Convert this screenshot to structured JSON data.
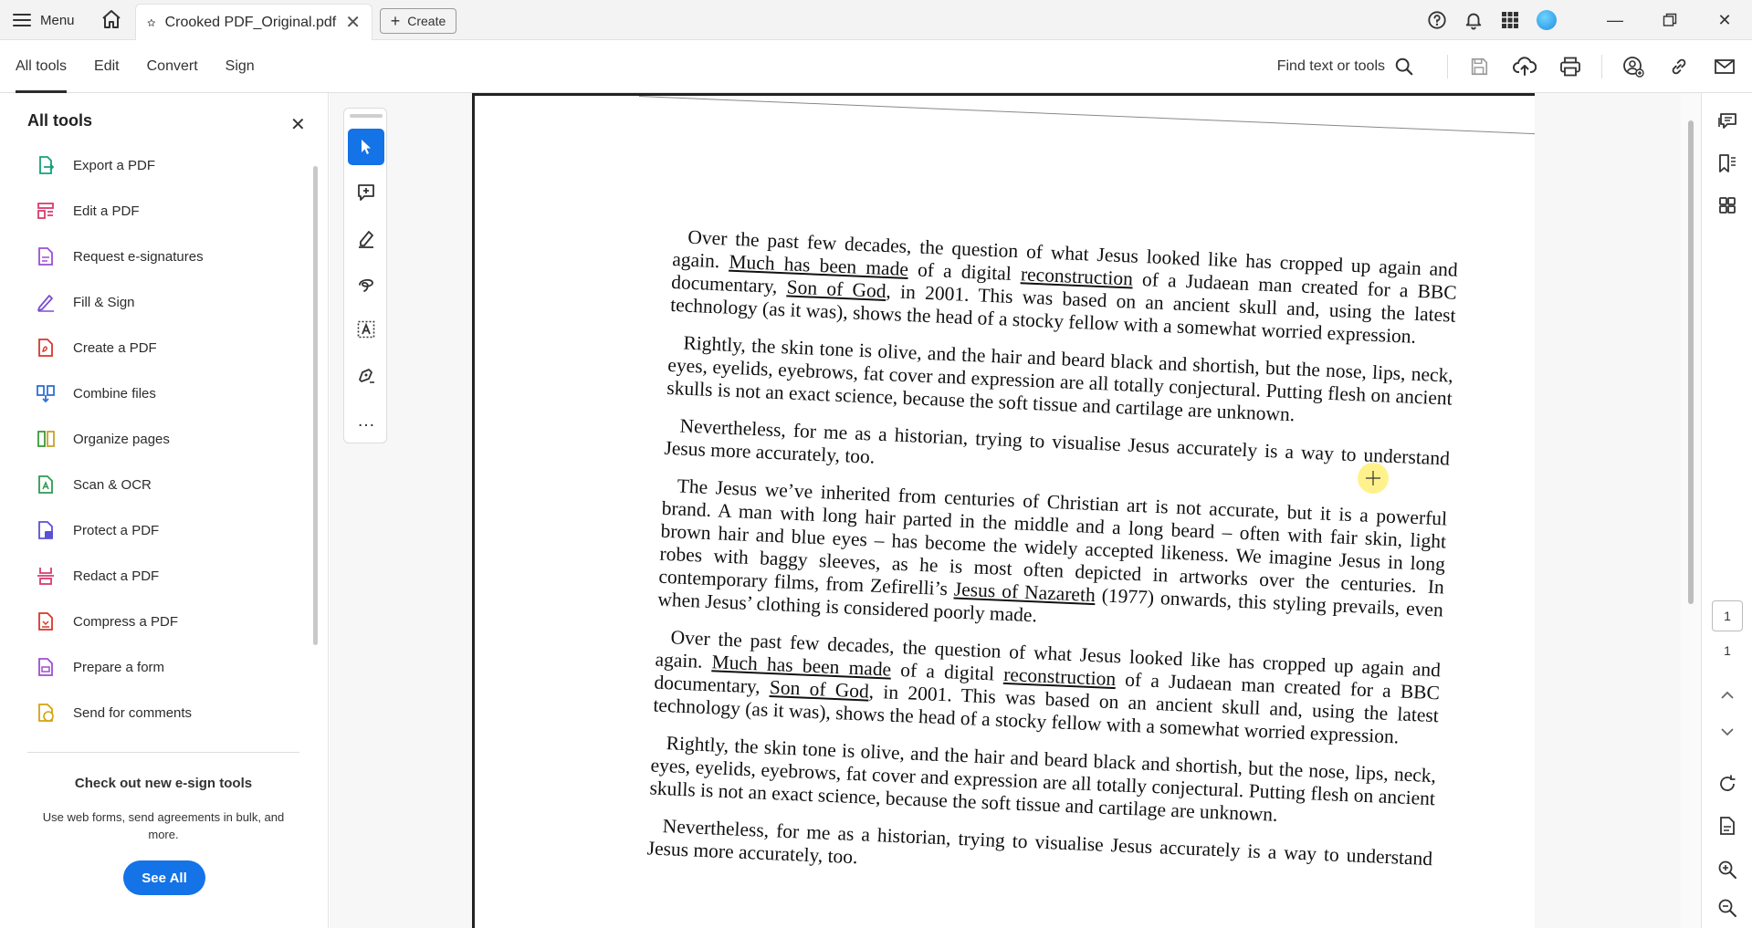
{
  "titlebar": {
    "menu_label": "Menu",
    "tab_title": "Crooked PDF_Original.pdf",
    "create_label": "Create",
    "avatar_color": "#1e8fe0"
  },
  "toolbar": {
    "tabs": [
      "All tools",
      "Edit",
      "Convert",
      "Sign"
    ],
    "find_label": "Find text or tools"
  },
  "leftpanel": {
    "title": "All tools",
    "items": [
      {
        "label": "Export a PDF",
        "icon": "export-pdf-icon",
        "color": "#15a07a"
      },
      {
        "label": "Edit a PDF",
        "icon": "edit-pdf-icon",
        "color": "#d63d6e"
      },
      {
        "label": "Request e-signatures",
        "icon": "request-esign-icon",
        "color": "#9b4fd1"
      },
      {
        "label": "Fill & Sign",
        "icon": "fill-sign-icon",
        "color": "#7a4fd1"
      },
      {
        "label": "Create a PDF",
        "icon": "create-pdf-icon",
        "color": "#d9362b"
      },
      {
        "label": "Combine files",
        "icon": "combine-files-icon",
        "color": "#2d6fd6"
      },
      {
        "label": "Organize pages",
        "icon": "organize-pages-icon",
        "color": "#3a9a3a"
      },
      {
        "label": "Scan & OCR",
        "icon": "scan-ocr-icon",
        "color": "#2f9a52"
      },
      {
        "label": "Protect a PDF",
        "icon": "protect-pdf-icon",
        "color": "#5a50d6"
      },
      {
        "label": "Redact a PDF",
        "icon": "redact-pdf-icon",
        "color": "#d63d6e"
      },
      {
        "label": "Compress a PDF",
        "icon": "compress-pdf-icon",
        "color": "#d9362b"
      },
      {
        "label": "Prepare a form",
        "icon": "prepare-form-icon",
        "color": "#9b4fd1"
      },
      {
        "label": "Send for comments",
        "icon": "send-comments-icon",
        "color": "#d4a30d"
      }
    ],
    "promo_title": "Check out new e-sign tools",
    "promo_text": "Use web forms, send agreements in bulk, and more.",
    "see_all_label": "See All"
  },
  "document": {
    "paragraphs": [
      {
        "parts": [
          {
            "t": "Over the past few decades, the question of what Jesus looked like has cropped up again and again. "
          },
          {
            "t": "Much has been made",
            "u": true
          },
          {
            "t": " of a digital "
          },
          {
            "t": "reconstruction",
            "u": true
          },
          {
            "t": " of a Judaean man created for a BBC documentary, "
          },
          {
            "t": "Son of God",
            "u": true
          },
          {
            "t": ", in 2001. This was based on an ancient skull and, using the latest technology (as it was), shows the head of a stocky fellow with a somewhat worried expression."
          }
        ]
      },
      {
        "parts": [
          {
            "t": "Rightly, the skin tone is olive, and the hair and beard black and shortish, but the nose, lips, neck, eyes, eyelids, eyebrows, fat cover and expression are all totally conjectural. Putting flesh on ancient skulls is not an exact science, because the soft tissue and cartilage are unknown."
          }
        ]
      },
      {
        "parts": [
          {
            "t": "Nevertheless, for me as a historian, trying to visualise Jesus accurately is a way to understand Jesus more accurately, too."
          }
        ]
      },
      {
        "parts": [
          {
            "t": "The Jesus we’ve inherited from centuries of Christian art is not accurate, but it is a powerful brand. A man with long hair parted in the middle and a long beard – often with fair skin, light brown hair and blue eyes – has become the widely accepted likeness. We imagine Jesus in long robes with baggy sleeves, as he is most often depicted in artworks over the centuries. In contemporary films, from Zefirelli’s "
          },
          {
            "t": "Jesus of Nazareth",
            "u": true
          },
          {
            "t": " (1977) onwards, this styling prevails, even when Jesus’ clothing is considered poorly made."
          }
        ]
      },
      {
        "parts": [
          {
            "t": "Over the past few decades, the question of what Jesus looked like has cropped up again and again. "
          },
          {
            "t": "Much has been made",
            "u": true
          },
          {
            "t": " of a digital "
          },
          {
            "t": "reconstruction",
            "u": true
          },
          {
            "t": " of a Judaean man created for a BBC documentary, "
          },
          {
            "t": "Son of God",
            "u": true
          },
          {
            "t": ", in 2001. This was based on an ancient skull and, using the latest technology (as it was), shows the head of a stocky fellow with a somewhat worried expression."
          }
        ]
      },
      {
        "parts": [
          {
            "t": "Rightly, the skin tone is olive, and the hair and beard black and shortish, but the nose, lips, neck, eyes, eyelids, eyebrows, fat cover and expression are all totally conjectural. Putting flesh on ancient skulls is not an exact science, because the soft tissue and cartilage are unknown."
          }
        ]
      },
      {
        "parts": [
          {
            "t": "Nevertheless, for me as a historian, trying to visualise Jesus accurately is a way to understand Jesus more accurately, too."
          }
        ]
      }
    ]
  },
  "navigation": {
    "current_page": "1",
    "total_pages": "1"
  },
  "colors": {
    "accent": "#1473e6"
  }
}
